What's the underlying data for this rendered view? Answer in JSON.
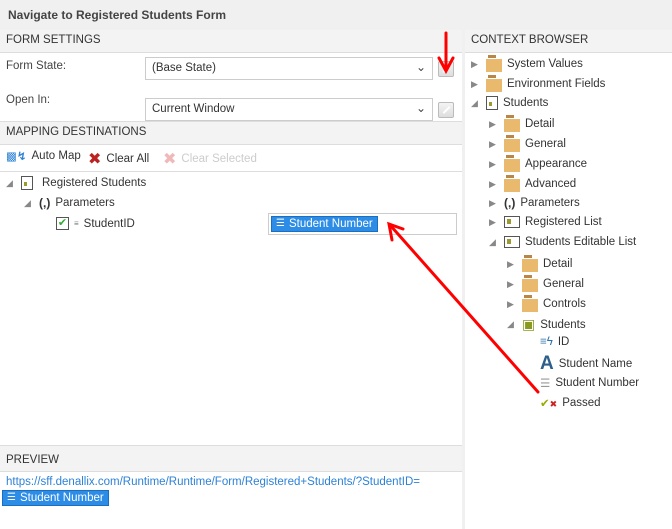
{
  "title": "Navigate to Registered Students Form",
  "form_settings": {
    "header": "FORM SETTINGS",
    "form_state_label": "Form State:",
    "form_state_value": "(Base State)",
    "open_in_label": "Open In:",
    "open_in_value": "Current Window"
  },
  "mapping": {
    "header": "MAPPING DESTINATIONS",
    "auto_map": "Auto Map",
    "clear_all": "Clear All",
    "clear_selected": "Clear Selected",
    "tree": {
      "root": "Registered Students",
      "parameters": "Parameters",
      "param": "StudentID",
      "mapped_value": "Student Number"
    }
  },
  "preview": {
    "header": "PREVIEW",
    "url": "https://sff.denallix.com/Runtime/Runtime/Form/Registered+Students/?StudentID=",
    "token": "Student Number"
  },
  "context_browser": {
    "header": "CONTEXT BROWSER",
    "items": [
      "System Values",
      "Environment Fields",
      "Students",
      "Detail",
      "General",
      "Appearance",
      "Advanced",
      "Parameters",
      "Registered List",
      "Students Editable List",
      "Detail",
      "General",
      "Controls",
      "Students",
      "ID",
      "Student Name",
      "Student Number",
      "Passed"
    ]
  },
  "colors": {
    "accent": "#2c8ce6",
    "annotation": "#ff0000",
    "folder": "#e9b96e"
  }
}
